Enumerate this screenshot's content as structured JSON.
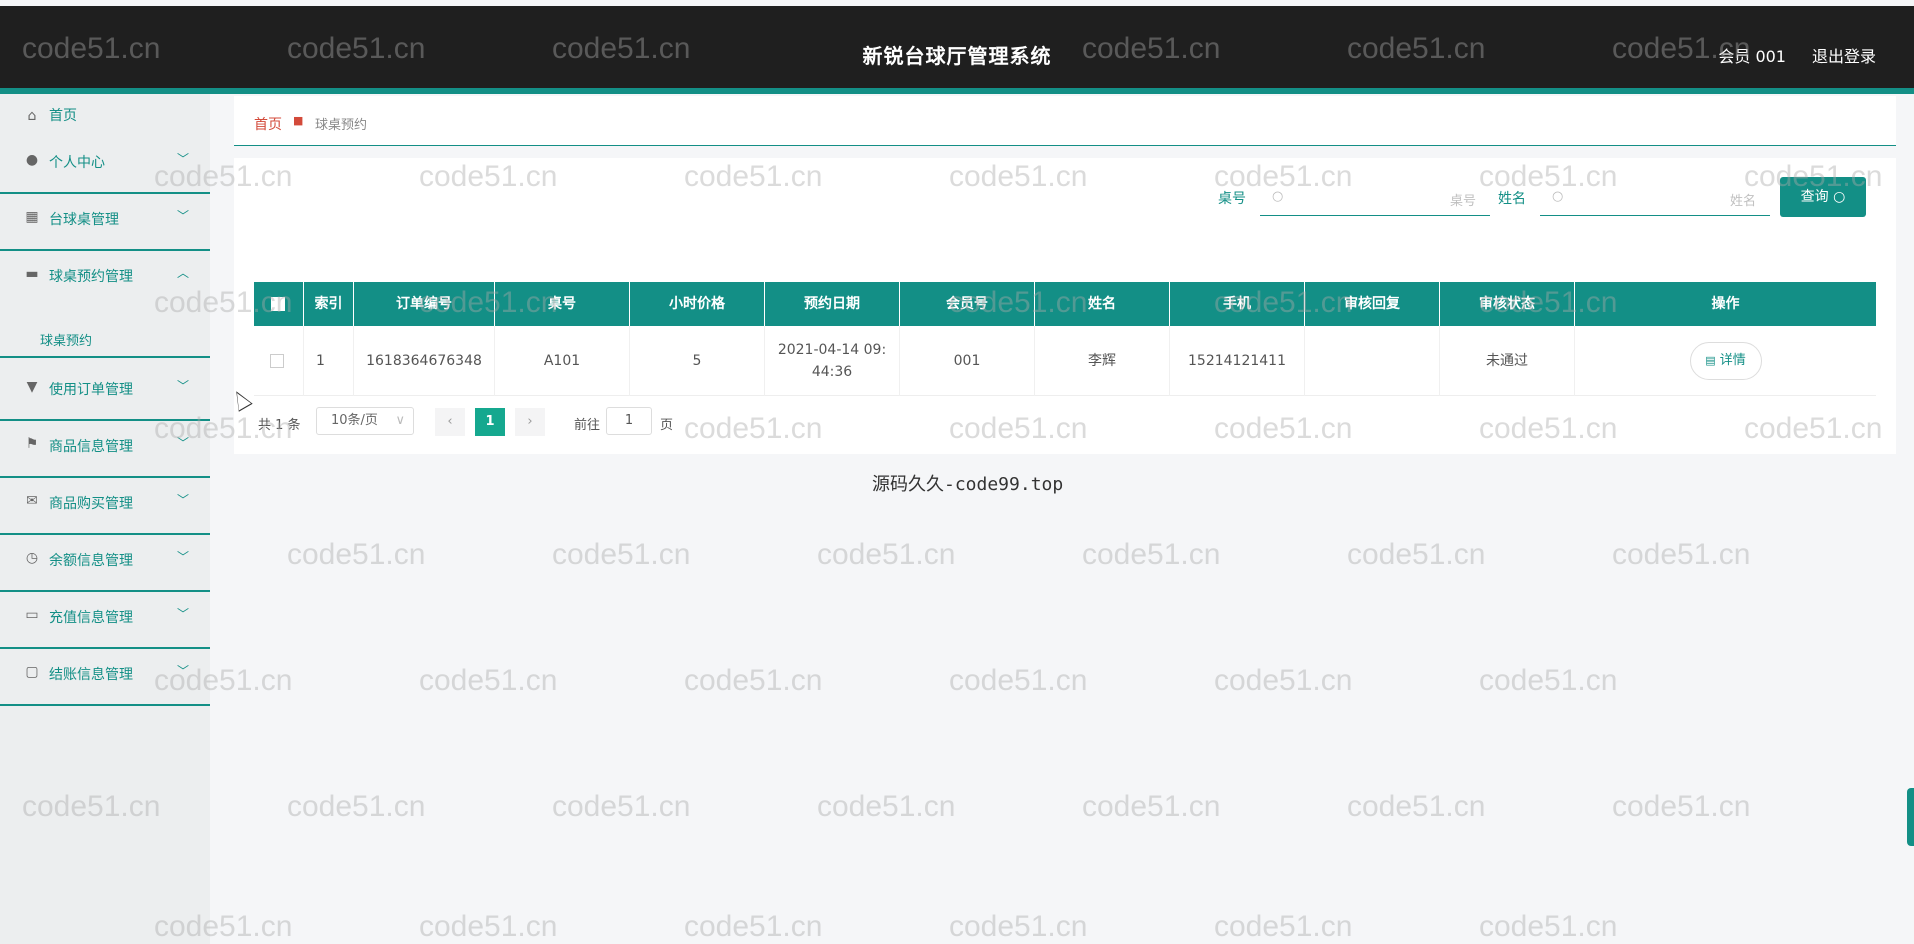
{
  "header": {
    "title": "新锐台球厅管理系统",
    "user": "会员 001",
    "logout": "退出登录"
  },
  "sidebar": {
    "items": [
      {
        "label": "首页",
        "icon": "home-icon"
      },
      {
        "label": "个人中心",
        "icon": "user-icon"
      },
      {
        "label": "台球桌管理",
        "icon": "grid-icon"
      },
      {
        "label": "球桌预约管理",
        "icon": "monitor-icon"
      },
      {
        "label": "使用订单管理",
        "icon": "bookmark-icon"
      },
      {
        "label": "商品信息管理",
        "icon": "flag-icon"
      },
      {
        "label": "商品购买管理",
        "icon": "mail-icon"
      },
      {
        "label": "余额信息管理",
        "icon": "clock-icon"
      },
      {
        "label": "充值信息管理",
        "icon": "message-icon"
      },
      {
        "label": "结账信息管理",
        "icon": "calendar-icon"
      }
    ],
    "sub_item": "球桌预约"
  },
  "breadcrumb": {
    "home": "首页",
    "current": "球桌预约"
  },
  "search": {
    "table_label": "桌号",
    "table_placeholder": "桌号",
    "name_label": "姓名",
    "name_placeholder": "姓名",
    "query_button": "查询"
  },
  "table": {
    "headers": [
      "索引",
      "订单编号",
      "桌号",
      "小时价格",
      "预约日期",
      "会员号",
      "姓名",
      "手机",
      "审核回复",
      "审核状态",
      "操作"
    ],
    "rows": [
      {
        "index": "1",
        "order_no": "1618364676348",
        "table_no": "A101",
        "hour_price": "5",
        "date": "2021-04-14 09:44:36",
        "member_no": "001",
        "name": "李辉",
        "phone": "15214121411",
        "reply": "",
        "status": "未通过",
        "action": "详情"
      }
    ]
  },
  "pagination": {
    "total": "共 1 条",
    "page_size": "10条/页",
    "current_page": "1",
    "goto_label": "前往",
    "goto_value": "1",
    "goto_unit": "页"
  },
  "footer": "源码久久-code99.top",
  "watermark": "code51.cn",
  "colors": {
    "accent": "#138f86",
    "header_bg": "#1f1f1f",
    "breadcrumb_home": "#d34a3a"
  }
}
